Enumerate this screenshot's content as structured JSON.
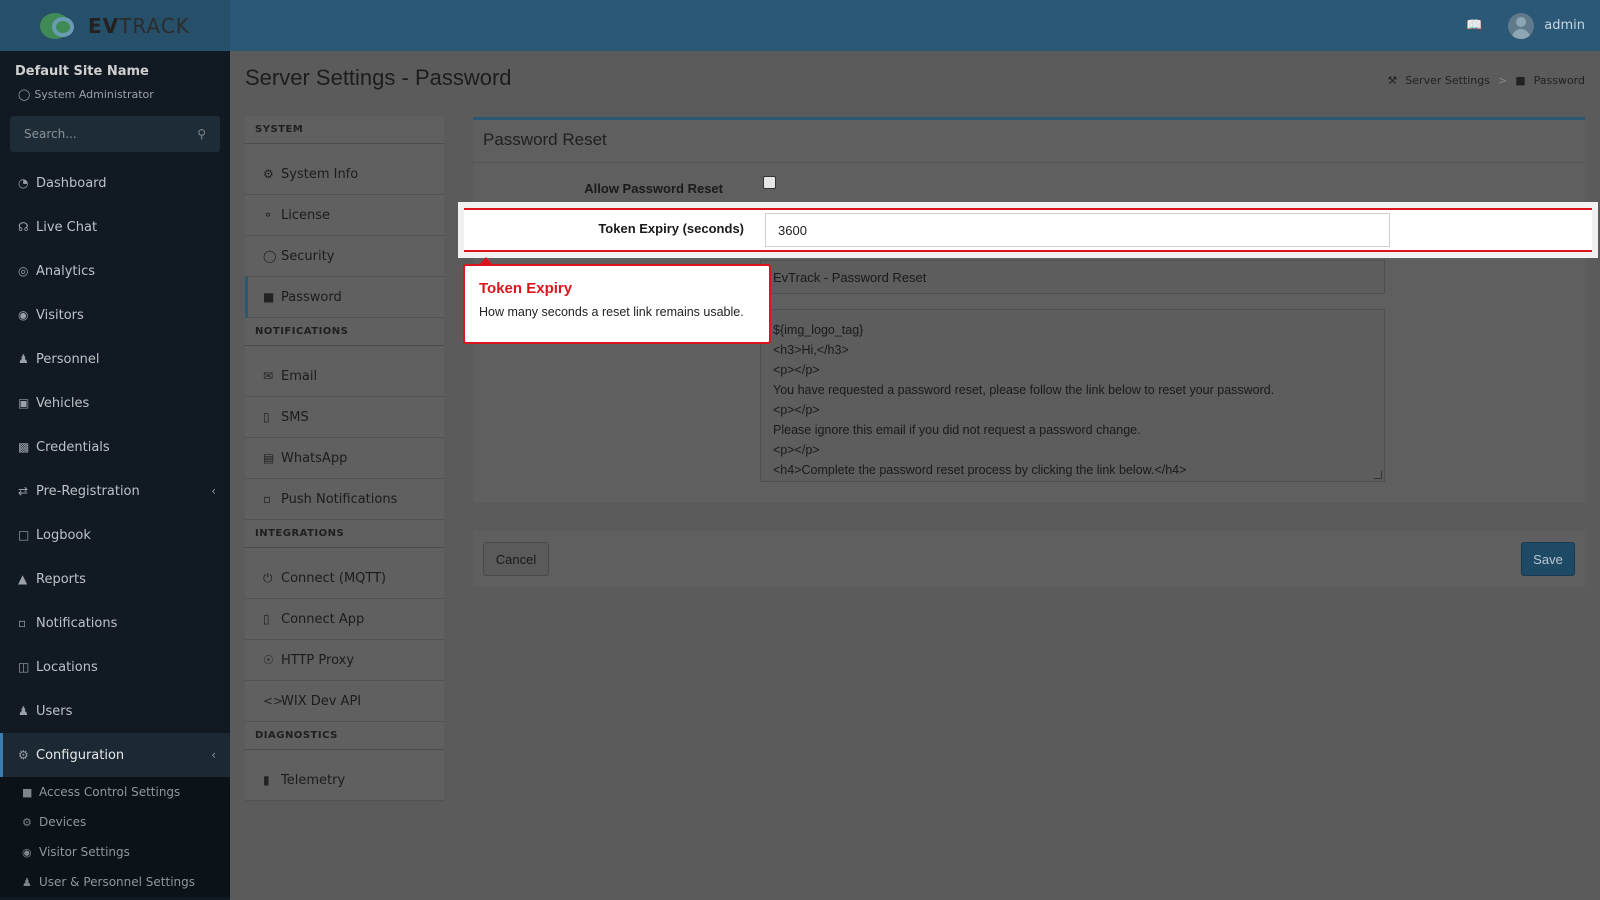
{
  "topbar": {
    "logo_prefix": "EV",
    "logo_suffix": "TRACK",
    "book_icon": "book-icon",
    "user_name": "admin"
  },
  "sidebar": {
    "site_name": "Default Site Name",
    "site_role": "System Administrator",
    "search_placeholder": "Search...",
    "items": [
      {
        "label": "Dashboard",
        "icon": "gauge-icon"
      },
      {
        "label": "Live Chat",
        "icon": "headset-icon"
      },
      {
        "label": "Analytics",
        "icon": "target-icon"
      },
      {
        "label": "Visitors",
        "icon": "eye-icon"
      },
      {
        "label": "Personnel",
        "icon": "user-icon"
      },
      {
        "label": "Vehicles",
        "icon": "car-icon"
      },
      {
        "label": "Credentials",
        "icon": "id-card-icon"
      },
      {
        "label": "Pre-Registration",
        "icon": "arrows-icon"
      },
      {
        "label": "Logbook",
        "icon": "book-icon"
      },
      {
        "label": "Reports",
        "icon": "chart-icon"
      },
      {
        "label": "Notifications",
        "icon": "bell-icon"
      },
      {
        "label": "Locations",
        "icon": "map-icon"
      },
      {
        "label": "Users",
        "icon": "users-icon"
      },
      {
        "label": "Configuration",
        "icon": "gear-icon"
      }
    ],
    "subitems": [
      {
        "label": "Access Control Settings",
        "icon": "lock-icon"
      },
      {
        "label": "Devices",
        "icon": "gear-icon"
      },
      {
        "label": "Visitor Settings",
        "icon": "eye-icon"
      },
      {
        "label": "User & Personnel Settings",
        "icon": "users-icon"
      }
    ]
  },
  "main": {
    "page_title": "Server Settings - Password",
    "breadcrumb": {
      "parent": "Server Settings",
      "current": "Password"
    }
  },
  "settings_nav": {
    "sections": [
      {
        "header": "SYSTEM",
        "items": [
          "System Info",
          "License",
          "Security",
          "Password"
        ]
      },
      {
        "header": "NOTIFICATIONS",
        "items": [
          "Email",
          "SMS",
          "WhatsApp",
          "Push Notifications"
        ]
      },
      {
        "header": "INTEGRATIONS",
        "items": [
          "Connect (MQTT)",
          "Connect App",
          "HTTP Proxy",
          "WIX Dev API"
        ]
      },
      {
        "header": "DIAGNOSTICS",
        "items": [
          "Telemetry"
        ]
      }
    ],
    "active_item": "Password"
  },
  "panel": {
    "title": "Password Reset",
    "allow_reset_label": "Allow Password Reset",
    "allow_reset_checked": false,
    "token_expiry_label": "Token Expiry (seconds)",
    "token_expiry_value": "3600",
    "subject_value": "EvTrack - Password Reset",
    "template_lines": [
      "${img_logo_tag}",
      "<h3>Hi,</h3>",
      "<p></p>",
      "You have requested a password reset, please follow the link below to reset your password.",
      "<p></p>",
      "Please ignore this email if you did not request a password change.",
      "<p></p>",
      "<h4>Complete the password reset process by clicking the link below.</h4>"
    ]
  },
  "actions": {
    "cancel_label": "Cancel",
    "save_label": "Save"
  },
  "tooltip": {
    "title": "Token Expiry",
    "body": "How many seconds a reset link remains usable."
  },
  "colors": {
    "topbar": "#2a5876",
    "sidebar": "#111a22",
    "accent": "#3c7eb0",
    "highlight": "#d9161c"
  }
}
